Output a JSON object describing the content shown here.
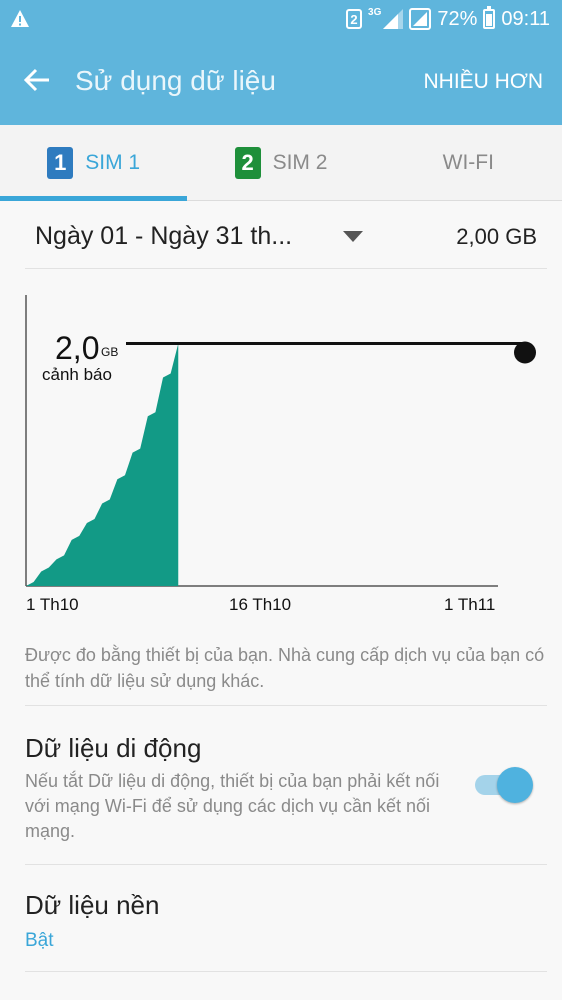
{
  "status_bar": {
    "sim_slot": "2",
    "network_type": "3G",
    "battery_level": 0.72,
    "battery": "72%",
    "time": "09:11",
    "icons": [
      "warning-icon",
      "sim-2-icon",
      "signal-icon",
      "signal-icon",
      "battery-icon"
    ]
  },
  "app_bar": {
    "title": "Sử dụng dữ liệu",
    "more_label": "NHIỀU HƠN",
    "back_icon": "arrow-left-icon",
    "color": "#5fb5dc"
  },
  "tabs": [
    {
      "icon_text": "1",
      "label": "SIM 1",
      "active": true,
      "icon_color": "#2e7bbf"
    },
    {
      "icon_text": "2",
      "label": "SIM 2",
      "active": false,
      "icon_color": "#1e8f3a"
    },
    {
      "label": "WI-FI",
      "active": false
    }
  ],
  "cycle": {
    "range": "Ngày 01 - Ngày 31 th...",
    "limit": "2,00 GB"
  },
  "chart": {
    "warning_value": "2,0",
    "warning_unit": "GB",
    "warning_label": "cảnh báo",
    "x_labels": [
      "1 Th10",
      "16 Th10",
      "1 Th11"
    ]
  },
  "chart_data": {
    "type": "area",
    "x": [
      1,
      2,
      3,
      4,
      5,
      6,
      7,
      8,
      9,
      10,
      11
    ],
    "values": [
      0.0,
      0.12,
      0.22,
      0.38,
      0.52,
      0.68,
      0.88,
      1.1,
      1.4,
      1.72,
      2.0
    ],
    "warning_threshold": 2.0,
    "ylim": [
      0,
      2.4
    ],
    "xlim": [
      1,
      32
    ],
    "fill_color": "#129a86"
  },
  "note": "Được đo bằng thiết bị của bạn. Nhà cung cấp dịch vụ của bạn có thể tính dữ liệu sử dụng khác.",
  "mobile_data": {
    "title": "Dữ liệu di động",
    "description": "Nếu tắt Dữ liệu di động, thiết bị của bạn phải kết nối với mạng Wi-Fi để sử dụng các dịch vụ cần kết nối mạng.",
    "enabled": true,
    "accent": "#4fb2df"
  },
  "background_data": {
    "title": "Dữ liệu nền",
    "value": "Bật"
  }
}
